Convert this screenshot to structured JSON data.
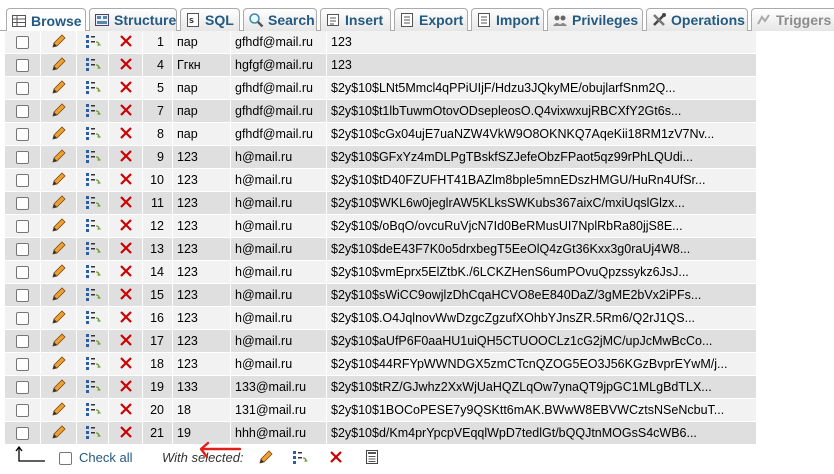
{
  "tabs": [
    {
      "label": "Browse",
      "icon": "browse-icon",
      "active": true
    },
    {
      "label": "Structure",
      "icon": "structure-icon"
    },
    {
      "label": "SQL",
      "icon": "sql-icon"
    },
    {
      "label": "Search",
      "icon": "search-icon"
    },
    {
      "label": "Insert",
      "icon": "insert-icon"
    },
    {
      "label": "Export",
      "icon": "export-icon"
    },
    {
      "label": "Import",
      "icon": "import-icon"
    },
    {
      "label": "Privileges",
      "icon": "privileges-icon"
    },
    {
      "label": "Operations",
      "icon": "operations-icon"
    },
    {
      "label": "Triggers",
      "icon": "triggers-icon",
      "disabled": true
    }
  ],
  "rows": [
    {
      "id": "1",
      "name": "пар",
      "email": "gfhdf@mail.ru",
      "password": "123"
    },
    {
      "id": "4",
      "name": "Ггкн",
      "email": "hgfgf@mail.ru",
      "password": "123"
    },
    {
      "id": "5",
      "name": "пар",
      "email": "gfhdf@mail.ru",
      "password": "$2y$10$LNt5Mmcl4qPPiUIjF/Hdzu3JQkyME/obujlarfSnm2Q..."
    },
    {
      "id": "7",
      "name": "пар",
      "email": "gfhdf@mail.ru",
      "password": "$2y$10$t1lbTuwmOtovODsepleosO.Q4vixwxujRBCXfY2Gt6s..."
    },
    {
      "id": "8",
      "name": "пар",
      "email": "gfhdf@mail.ru",
      "password": "$2y$10$cGx04ujE7uaNZW4VkW9O8OKNKQ7AqeKii18RM1zV7Nv..."
    },
    {
      "id": "9",
      "name": "123",
      "email": "h@mail.ru",
      "password": "$2y$10$GFxYz4mDLPgTBskfSZJefeObzFPaot5qz99rPhLQUdi..."
    },
    {
      "id": "10",
      "name": "123",
      "email": "h@mail.ru",
      "password": "$2y$10$tD40FZUFHT41BAZlm8bple5mnEDszHMGU/HuRn4UfSr..."
    },
    {
      "id": "11",
      "name": "123",
      "email": "h@mail.ru",
      "password": "$2y$10$WKL6w0jeglrAW5KLksSWKubs367aixC/mxiUqslGlzx..."
    },
    {
      "id": "12",
      "name": "123",
      "email": "h@mail.ru",
      "password": "$2y$10$/oBqO/ovcuRuVjcN7Id0BeRMusUI7NplRbRa80jjS8E..."
    },
    {
      "id": "13",
      "name": "123",
      "email": "h@mail.ru",
      "password": "$2y$10$deE43F7K0o5drxbegT5EeOlQ4zGt36Kxx3g0raUj4W8..."
    },
    {
      "id": "14",
      "name": "123",
      "email": "h@mail.ru",
      "password": "$2y$10$vmEprx5ElZtbK./6LCKZHenS6umPOvuQpzssykz6JsJ..."
    },
    {
      "id": "15",
      "name": "123",
      "email": "h@mail.ru",
      "password": "$2y$10$sWiCC9owjlzDhCqaHCVO8eE840DaZ/3gME2bVx2iPFs..."
    },
    {
      "id": "16",
      "name": "123",
      "email": "h@mail.ru",
      "password": "$2y$10$.O4JqlnovWwDzgcZgzufXOhbYJnsZR.5Rm6/Q2rJ1QS..."
    },
    {
      "id": "17",
      "name": "123",
      "email": "h@mail.ru",
      "password": "$2y$10$aUfP6F0aaHU1uiQH5CTUOOCLz1cG2jMC/upJcMwBcCo..."
    },
    {
      "id": "18",
      "name": "123",
      "email": "h@mail.ru",
      "password": "$2y$10$44RFYpWWNDGX5zmCTcnQZOG5EO3J56KGzBvprEYwM/j..."
    },
    {
      "id": "19",
      "name": "133",
      "email": "133@mail.ru",
      "password": "$2y$10$tRZ/GJwhz2XxWjUaHQZLqOw7ynaQT9jpGC1MLgBdTLX..."
    },
    {
      "id": "20",
      "name": "18",
      "email": "131@mail.ru",
      "password": "$2y$10$1BOCoPESE7y9QSKtt6mAK.BWwW8EBVWCztsNSeNcbuT..."
    },
    {
      "id": "21",
      "name": "19",
      "email": "hhh@mail.ru",
      "password": "$2y$10$d/Km4prYpcpVEqqlWpD7tedlGt/bQQJtnMOGsS4cWB6..."
    }
  ],
  "footer": {
    "check_all": "Check all",
    "with_selected": "With selected:"
  },
  "colors": {
    "link": "#235a81",
    "row_odd": "#f2f2f2",
    "row_even": "#dfdfdf",
    "delete_red": "#cc0000",
    "annotation_red": "#e0201a"
  }
}
